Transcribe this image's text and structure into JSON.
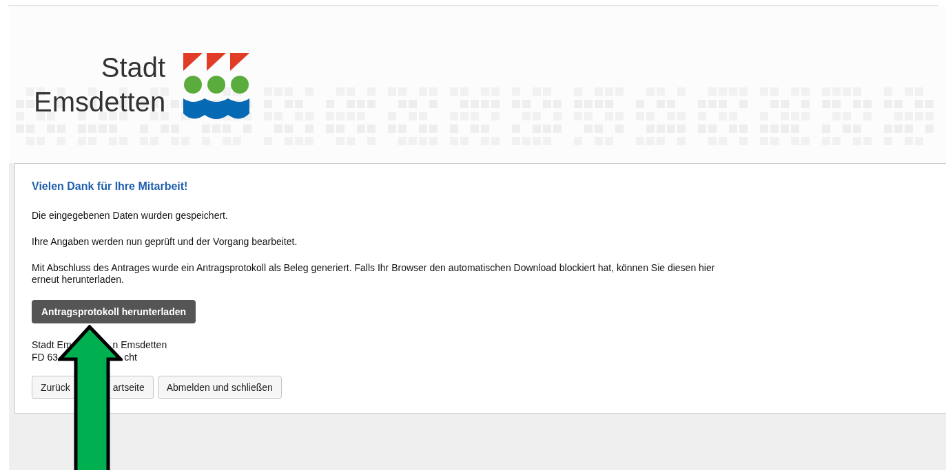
{
  "logo": {
    "line_1": "Stadt",
    "line_2": "Emsdetten"
  },
  "content": {
    "heading": "Vielen Dank für Ihre Mitarbeit!",
    "paragraphs": [
      "Die eingegebenen Daten wurden gespeichert.",
      "Ihre Angaben werden nun geprüft und der Vorgang bearbeitet.",
      "Mit Abschluss des Antrages wurde ein Antragsprotokoll als Beleg generiert. Falls Ihr Browser den automatischen Download blockiert hat, können Sie diesen hier erneut herunterladen."
    ],
    "download_button": "Antragsprotokoll herunterladen",
    "address_lines": [
      {
        "parts": [
          "Stadt Em",
          "n Emsdetten"
        ]
      },
      {
        "parts": [
          "FD 63",
          "cht"
        ]
      }
    ],
    "buttons": [
      {
        "parts": [
          "Zurück",
          "artseite"
        ]
      },
      {
        "parts": [
          "Abmelden und schließen"
        ]
      }
    ]
  }
}
